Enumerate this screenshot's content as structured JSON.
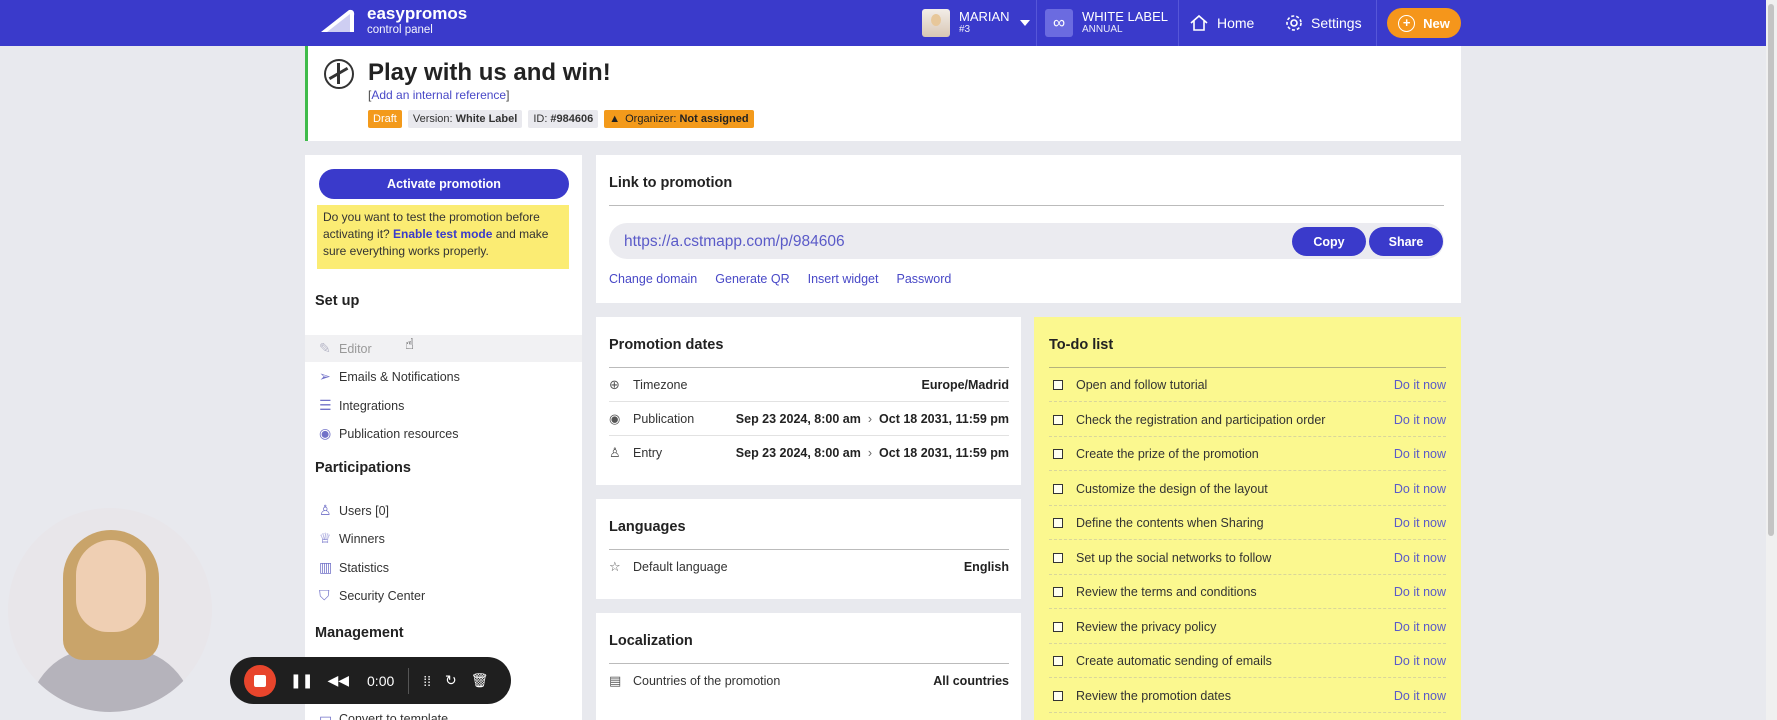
{
  "topbar": {
    "brand_name": "easypromos",
    "brand_sub": "control panel",
    "user_name": "MARIAN",
    "user_id": "#3",
    "plan_name": "WHITE LABEL",
    "plan_period": "ANNUAL",
    "home": "Home",
    "settings": "Settings",
    "new": "New"
  },
  "promo": {
    "title": "Play with us and win!",
    "ref_link": "Add an internal reference",
    "status": "Draft",
    "version_label": "Version:",
    "version": "White Label",
    "id_label": "ID:",
    "id": "#984606",
    "organizer_label": "Organizer:",
    "organizer": "Not assigned"
  },
  "left": {
    "activate": "Activate promotion",
    "test_pre": "Do you want to test the promotion before activating it?",
    "test_link": "Enable test mode",
    "test_post": "and make sure everything works properly.",
    "setup_title": "Set up",
    "setup": [
      "Editor",
      "Emails & Notifications",
      "Integrations",
      "Publication resources"
    ],
    "part_title": "Participations",
    "part": [
      "Users [0]",
      "Winners",
      "Statistics",
      "Security Center"
    ],
    "mgmt_title": "Management",
    "mgmt": [
      "Convert to template"
    ]
  },
  "link": {
    "title": "Link to promotion",
    "url": "https://a.cstmapp.com/p/984606",
    "copy": "Copy",
    "share": "Share",
    "actions": [
      "Change domain",
      "Generate QR",
      "Insert widget",
      "Password"
    ]
  },
  "dates": {
    "title": "Promotion dates",
    "timezone_label": "Timezone",
    "timezone": "Europe/Madrid",
    "publication_label": "Publication",
    "publication_start": "Sep 23 2024, 8:00 am",
    "publication_end": "Oct 18 2031, 11:59 pm",
    "entry_label": "Entry",
    "entry_start": "Sep 23 2024, 8:00 am",
    "entry_end": "Oct 18 2031, 11:59 pm"
  },
  "languages": {
    "title": "Languages",
    "default_label": "Default language",
    "default": "English"
  },
  "localization": {
    "title": "Localization",
    "countries_label": "Countries of the promotion",
    "countries": "All countries"
  },
  "todo": {
    "title": "To-do list",
    "action": "Do it now",
    "items": [
      "Open and follow tutorial",
      "Check the registration and participation order",
      "Create the prize of the promotion",
      "Customize the design of the layout",
      "Define the contents when Sharing",
      "Set up the social networks to follow",
      "Review the terms and conditions",
      "Review the privacy policy",
      "Create automatic sending of emails",
      "Review the promotion dates"
    ]
  },
  "recorder": {
    "time": "0:00"
  }
}
